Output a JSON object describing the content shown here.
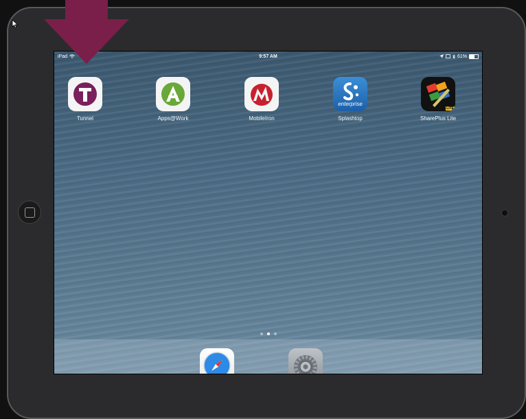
{
  "status_bar": {
    "device": "iPad",
    "time": "9:57 AM",
    "battery": "61%",
    "battery_level": 0.61
  },
  "apps": [
    {
      "label": "Tunnel",
      "icon": "tunnel-app-icon",
      "color": "#7a1f5c"
    },
    {
      "label": "Apps@Work",
      "icon": "apps-at-work-app-icon",
      "color": "#6aa83a"
    },
    {
      "label": "MobileIron",
      "icon": "mobileiron-app-icon",
      "color": "#c8202f"
    },
    {
      "label": "Splashtop",
      "icon": "splashtop-app-icon",
      "color": "#1d6fb8",
      "sublabel": "enterprise"
    },
    {
      "label": "SharePlus Lite",
      "icon": "shareplus-lite-app-icon",
      "color": "#1a1a1a",
      "badge": "LITE"
    }
  ],
  "dock": [
    {
      "icon": "safari-icon"
    },
    {
      "icon": "settings-icon"
    }
  ],
  "page_indicator": {
    "count": 3,
    "active": 2
  },
  "arrow_color": "#7a1f4a"
}
